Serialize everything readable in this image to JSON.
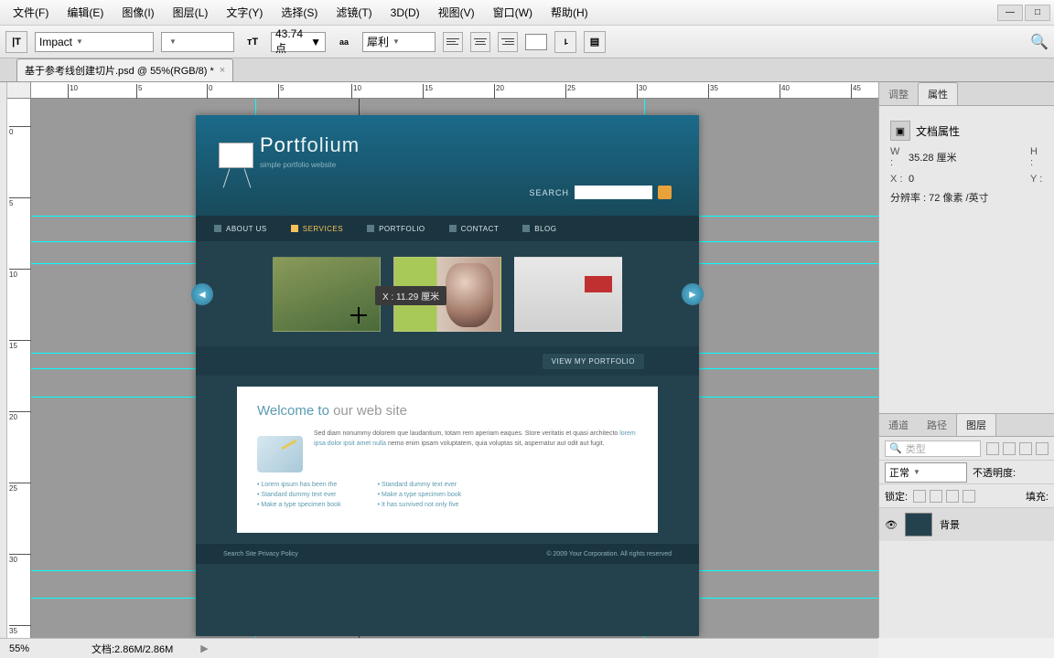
{
  "menu": {
    "file": "文件(F)",
    "edit": "编辑(E)",
    "image": "图像(I)",
    "layer": "图层(L)",
    "type": "文字(Y)",
    "select": "选择(S)",
    "filter": "滤镜(T)",
    "threeD": "3D(D)",
    "view": "视图(V)",
    "window": "窗口(W)",
    "help": "帮助(H)"
  },
  "opt": {
    "font": "Impact",
    "size": "43.74 点",
    "aa": "犀利",
    "toolglyph": "T"
  },
  "tab": {
    "title": "基于参考线创建切片.psd @ 55%(RGB/8) *"
  },
  "rulerH": [
    "10",
    "5",
    "0",
    "5",
    "10",
    "15",
    "20",
    "25",
    "30",
    "35",
    "40",
    "45"
  ],
  "rulerV": [
    "0",
    "5",
    "10",
    "15",
    "20",
    "25",
    "30",
    "35"
  ],
  "tooltip": "X :  11.29  厘米",
  "site": {
    "title_a": "Port",
    "title_b": "folium",
    "tagline": "simple portfolio website",
    "search": "SEARCH",
    "nav": [
      "ABOUT US",
      "SERVICES",
      "PORTFOLIO",
      "CONTACT",
      "BLOG"
    ],
    "viewbtn": "VIEW MY PORTFOLIO",
    "welcome_a": "Welcome to",
    "welcome_b": " our web site",
    "para": "Sed diam nonummy dolorem que laudantium, totam rem aperiam eaques. Store veritatis et quasi architecto ",
    "para_link": "lorem ipsa dolor ipsit amet nulla",
    "para2": " nemo enim ipsam voluptatem, quia voluptas sit, aspernatur aut odit aut fugit.",
    "links1": [
      "Lorem ipsum has been the",
      "Standard dummy text ever",
      "Make a type specimen book"
    ],
    "links2": [
      "Standard dummy text ever",
      "Make a type specimen book",
      "It has survived not only five"
    ],
    "foot_l": "Search Site     Privacy Policy",
    "foot_r": "© 2009 Your Corporation. All rights reserved"
  },
  "panel1": {
    "tab_adj": "调整",
    "tab_prop": "属性",
    "title": "文档属性",
    "W": "W :",
    "Wval": "35.28  厘米",
    "H": "H :",
    "X": "X :",
    "Xval": "0",
    "Y": "Y :",
    "res": "分辨率 : 72  像素 /英寸"
  },
  "panel2": {
    "tab_ch": "通道",
    "tab_path": "路径",
    "tab_layer": "图层",
    "search_ph": "类型",
    "blend": "正常",
    "opacity": "不透明度:",
    "lock": "锁定:",
    "fill": "填充:",
    "layer_name": "背景"
  },
  "status": {
    "zoom": "55%",
    "doc": "文档:2.86M/2.86M"
  }
}
